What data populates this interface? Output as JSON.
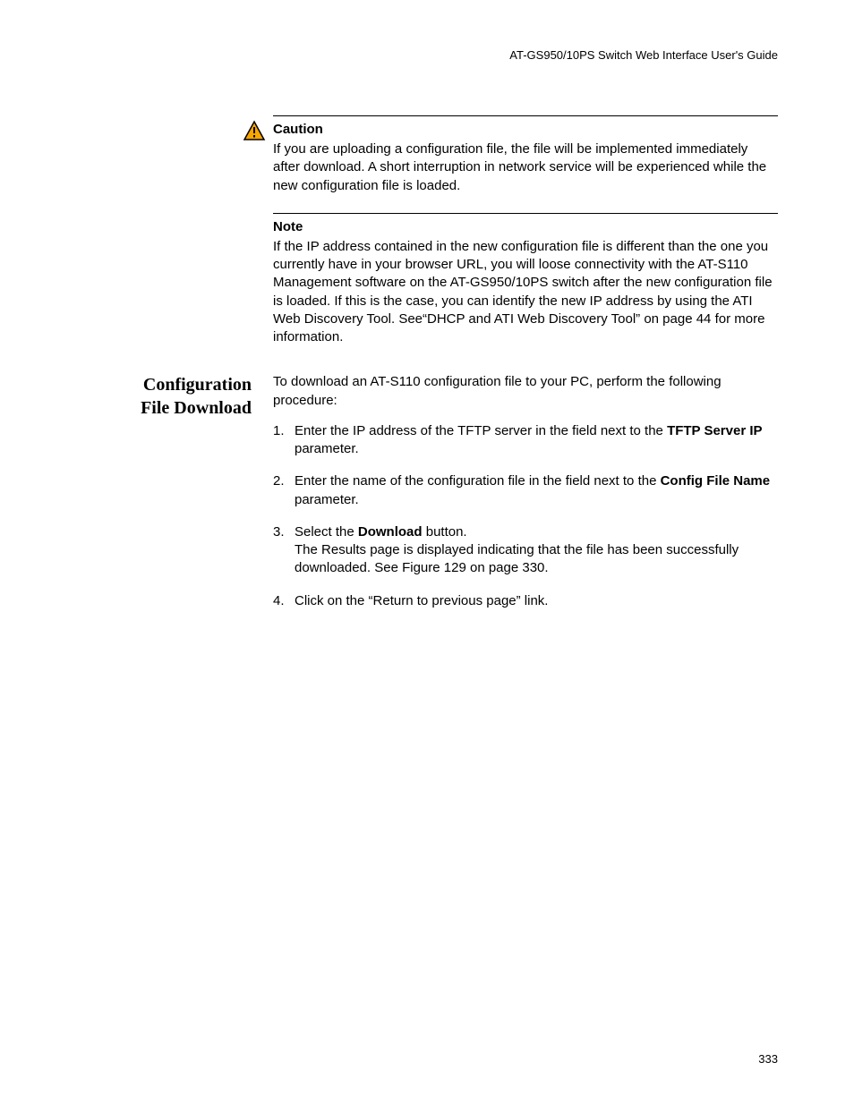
{
  "header": "AT-GS950/10PS Switch Web Interface User's Guide",
  "caution": {
    "label": "Caution",
    "text": "If you are uploading a configuration file, the file will be implemented immediately after download. A short interruption in network service will be experienced while the new configuration file is loaded."
  },
  "note": {
    "label": "Note",
    "text": "If the IP address contained in the new configuration file is different than the one you currently have in your browser URL, you will loose connectivity with the AT-S110 Management software on the AT-GS950/10PS switch after the new configuration file is loaded. If this is the case, you can identify the new IP address by using the ATI Web Discovery Tool. See“DHCP and ATI Web Discovery Tool” on page 44 for more information."
  },
  "section": {
    "heading_line1": "Configuration",
    "heading_line2": "File Download",
    "intro": "To download an AT-S110 configuration file to your PC, perform the following procedure:",
    "steps": {
      "s1_pre": "Enter the IP address of the TFTP server in the field next to the ",
      "s1_bold": "TFTP Server IP",
      "s1_post": " parameter.",
      "s2_pre": "Enter the name of the configuration file in the field next to the ",
      "s2_bold": "Config File Name",
      "s2_post": " parameter.",
      "s3_pre": "Select the ",
      "s3_bold": "Download",
      "s3_post": " button.",
      "s3_line2": "The Results page is displayed indicating that the file has been successfully downloaded. See Figure 129 on page 330.",
      "s4": "Click on the “Return to previous page” link."
    }
  },
  "page_number": "333"
}
